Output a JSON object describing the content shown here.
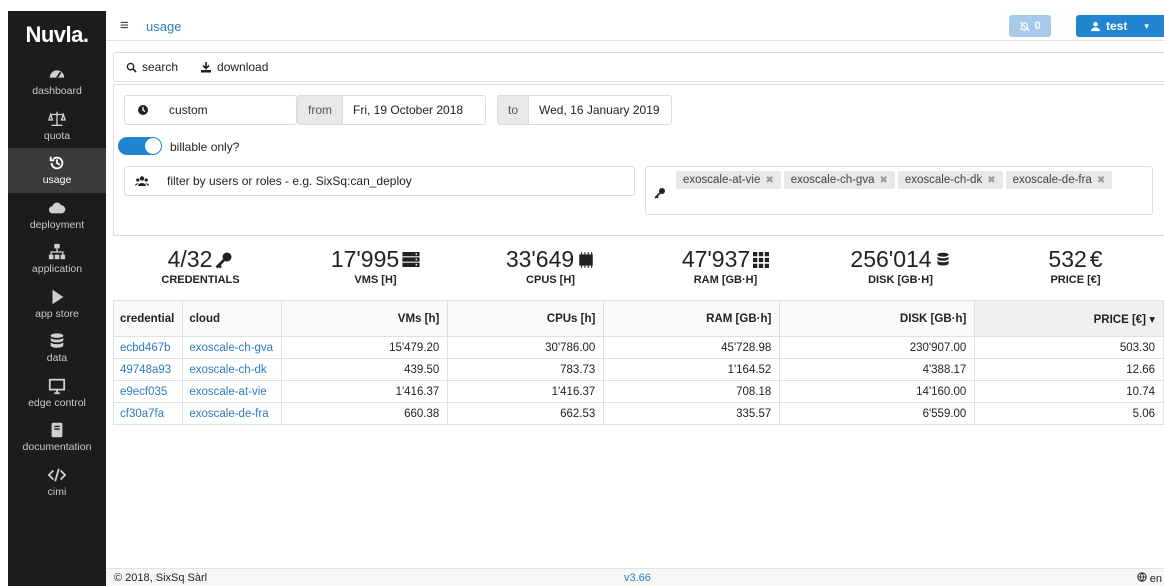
{
  "sidebar": {
    "logo": "Nuvla.",
    "items": [
      {
        "label": "dashboard"
      },
      {
        "label": "quota"
      },
      {
        "label": "usage"
      },
      {
        "label": "deployment"
      },
      {
        "label": "application"
      },
      {
        "label": "app store"
      },
      {
        "label": "data"
      },
      {
        "label": "edge control"
      },
      {
        "label": "documentation"
      },
      {
        "label": "cimi"
      }
    ]
  },
  "topbar": {
    "breadcrumb": "usage",
    "notifications": "0",
    "user": "test"
  },
  "toolbar": {
    "search": "search",
    "download": "download"
  },
  "filters": {
    "period": "custom",
    "from_label": "from",
    "from_value": "Fri, 19 October 2018",
    "to_label": "to",
    "to_value": "Wed, 16 January 2019",
    "billable_label": "billable only?",
    "users_placeholder": "filter by users or roles - e.g. SixSq:can_deploy",
    "clouds": [
      "exoscale-at-vie",
      "exoscale-ch-gva",
      "exoscale-ch-dk",
      "exoscale-de-fra"
    ]
  },
  "stats": [
    {
      "value": "4/32",
      "label": "CREDENTIALS"
    },
    {
      "value": "17'995",
      "label": "VMS [H]"
    },
    {
      "value": "33'649",
      "label": "CPUS [H]"
    },
    {
      "value": "47'937",
      "label": "RAM [GB·H]"
    },
    {
      "value": "256'014",
      "label": "DISK [GB·H]"
    },
    {
      "value": "532",
      "label": "PRICE [€]"
    }
  ],
  "price_symbol": "€",
  "table": {
    "headers": [
      "credential",
      "cloud",
      "VMs [h]",
      "CPUs [h]",
      "RAM [GB·h]",
      "DISK [GB·h]",
      "PRICE [€]"
    ],
    "rows": [
      [
        "ecbd467b",
        "exoscale-ch-gva",
        "15'479.20",
        "30'786.00",
        "45'728.98",
        "230'907.00",
        "503.30"
      ],
      [
        "49748a93",
        "exoscale-ch-dk",
        "439.50",
        "783.73",
        "1'164.52",
        "4'388.17",
        "12.66"
      ],
      [
        "e9ecf035",
        "exoscale-at-vie",
        "1'416.37",
        "1'416.37",
        "708.18",
        "14'160.00",
        "10.74"
      ],
      [
        "cf30a7fa",
        "exoscale-de-fra",
        "660.38",
        "662.53",
        "335.57",
        "6'559.00",
        "5.06"
      ]
    ]
  },
  "footer": {
    "copyright": "© 2018, SixSq Sàrl",
    "version": "v3.66",
    "language": "en"
  },
  "colors": {
    "sidebar": "#1b1c1d",
    "primary": "#2185d0",
    "link": "#2f7bbf"
  }
}
